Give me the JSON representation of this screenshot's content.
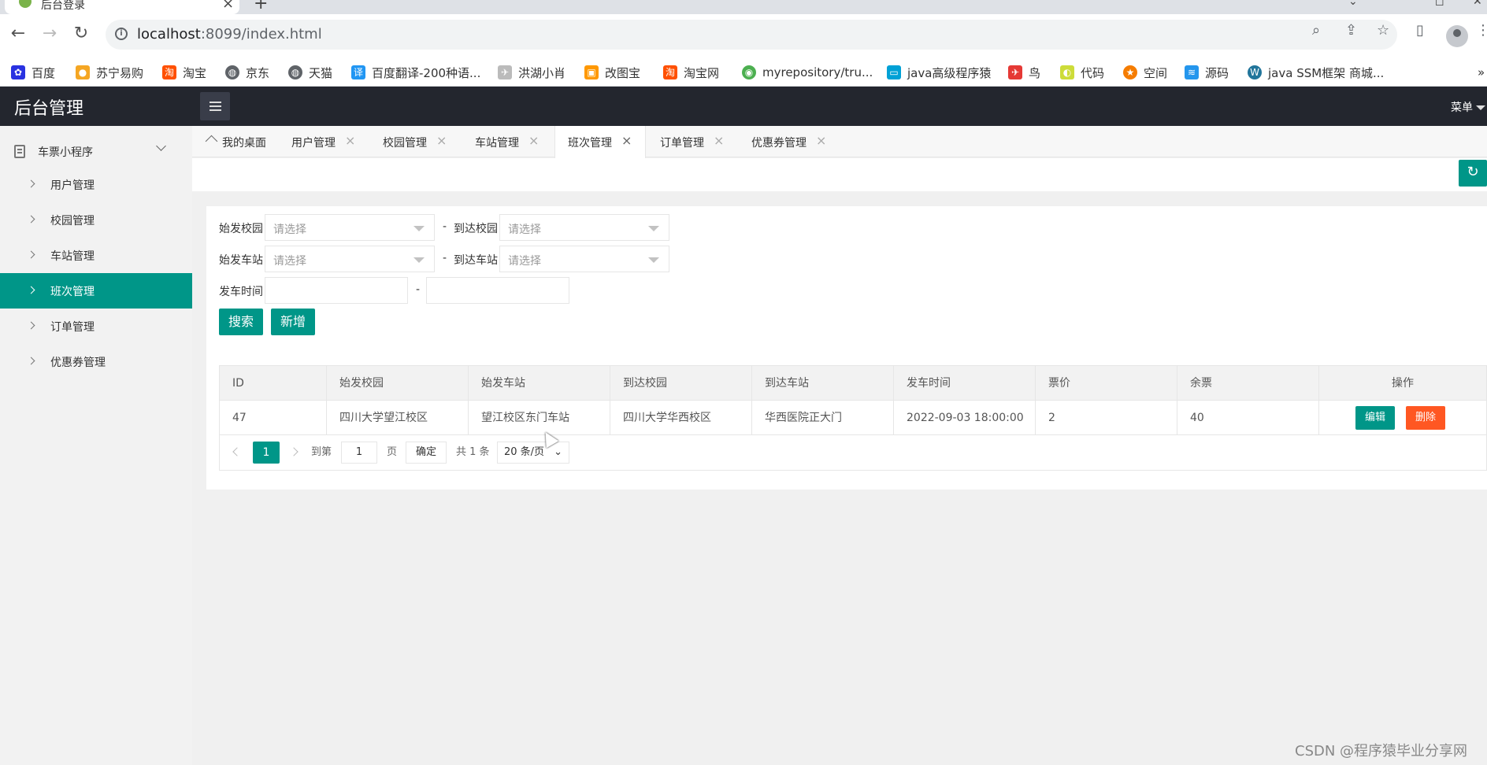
{
  "browser": {
    "tab_title": "后台登录",
    "url_host": "localhost",
    "url_rest": ":8099/index.html",
    "bookmarks": [
      {
        "label": "百度",
        "icon": "baidu-paw-icon",
        "color": "#2932e1"
      },
      {
        "label": "苏宁易购",
        "icon": "suning-lion-icon",
        "color": "#f5a623"
      },
      {
        "label": "淘宝",
        "icon": "taobao-icon",
        "color": "#ff5000"
      },
      {
        "label": "京东",
        "icon": "globe-icon",
        "color": "#5f6368"
      },
      {
        "label": "天猫",
        "icon": "globe-icon",
        "color": "#5f6368"
      },
      {
        "label": "百度翻译-200种语...",
        "icon": "translate-icon",
        "color": "#2196f3"
      },
      {
        "label": "洪湖小肖",
        "icon": "bird-icon",
        "color": "#999999"
      },
      {
        "label": "改图宝",
        "icon": "gaitubao-icon",
        "color": "#ff9800"
      },
      {
        "label": "淘宝网",
        "icon": "taobao-icon",
        "color": "#ff5000"
      },
      {
        "label": "myrepository/tru...",
        "icon": "chrome-icon",
        "color": "#4caf50"
      },
      {
        "label": "java高级程序猿",
        "icon": "bilibili-icon",
        "color": "#00a1d6"
      },
      {
        "label": "鸟",
        "icon": "bird-icon",
        "color": "#e53935"
      },
      {
        "label": "代码",
        "icon": "code-icon",
        "color": "#cddc39"
      },
      {
        "label": "空间",
        "icon": "qzone-icon",
        "color": "#f57c00"
      },
      {
        "label": "源码",
        "icon": "docker-icon",
        "color": "#2496ed"
      },
      {
        "label": "java SSM框架 商城...",
        "icon": "wordpress-icon",
        "color": "#21759b"
      }
    ]
  },
  "header": {
    "logo": "后台管理",
    "menu_label": "菜单"
  },
  "sidebar": {
    "group_label": "车票小程序",
    "items": [
      {
        "label": "用户管理"
      },
      {
        "label": "校园管理"
      },
      {
        "label": "车站管理"
      },
      {
        "label": "班次管理"
      },
      {
        "label": "订单管理"
      },
      {
        "label": "优惠券管理"
      }
    ]
  },
  "tabs": [
    {
      "label": "我的桌面"
    },
    {
      "label": "用户管理"
    },
    {
      "label": "校园管理"
    },
    {
      "label": "车站管理"
    },
    {
      "label": "班次管理"
    },
    {
      "label": "订单管理"
    },
    {
      "label": "优惠券管理"
    }
  ],
  "filters": {
    "from_campus_label": "始发校园",
    "to_campus_label": "到达校园",
    "from_station_label": "始发车站",
    "to_station_label": "到达车站",
    "depart_time_label": "发车时间",
    "select_placeholder": "请选择",
    "dash": "-",
    "search_label": "搜索",
    "add_label": "新增"
  },
  "table": {
    "columns": [
      "ID",
      "始发校园",
      "始发车站",
      "到达校园",
      "到达车站",
      "发车时间",
      "票价",
      "余票",
      "操作"
    ],
    "rows": [
      {
        "id": "47",
        "from_campus": "四川大学望江校区",
        "from_station": "望江校区东门车站",
        "to_campus": "四川大学华西校区",
        "to_station": "华西医院正大门",
        "depart_time": "2022-09-03 18:00:00",
        "price": "2",
        "remaining": "40"
      }
    ],
    "edit_label": "编辑",
    "delete_label": "删除"
  },
  "pagination": {
    "current_page": "1",
    "goto_label": "到第",
    "goto_value": "1",
    "page_unit": "页",
    "confirm_label": "确定",
    "total_label": "共 1 条",
    "page_size": "20 条/页"
  },
  "watermark": "CSDN @程序猿毕业分享网",
  "colors": {
    "primary": "#009688",
    "danger": "#ff5722",
    "header_bg": "#23262e"
  }
}
